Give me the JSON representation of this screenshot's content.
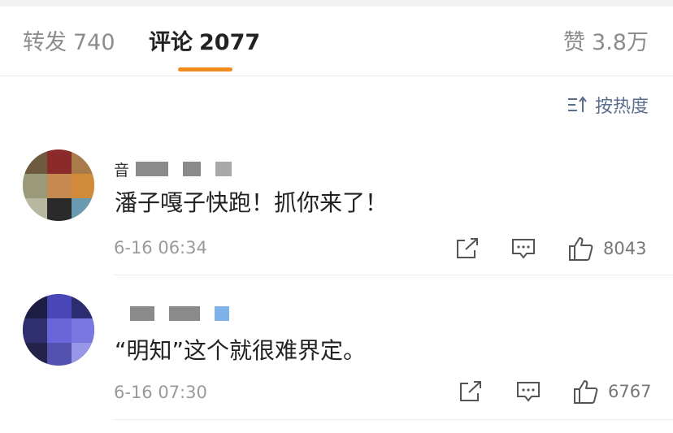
{
  "tabs": {
    "repost": {
      "label": "转发",
      "count": "740"
    },
    "comments": {
      "label": "评论",
      "count": "2077"
    },
    "likes": {
      "label": "赞",
      "count": "3.8万"
    }
  },
  "sort": {
    "label": "按热度",
    "icon": "sort-icon"
  },
  "colors": {
    "accent": "#f28c1c",
    "sort_text": "#5a6e8c",
    "muted": "#9a9a9a"
  },
  "comments": [
    {
      "name_visible": "音",
      "text": "潘子嘎子快跑！抓你来了！",
      "time": "6-16 06:34",
      "likes": "8043"
    },
    {
      "name_visible": "",
      "text": "“明知”这个就很难界定。",
      "time": "6-16 07:30",
      "likes": "6767"
    }
  ]
}
